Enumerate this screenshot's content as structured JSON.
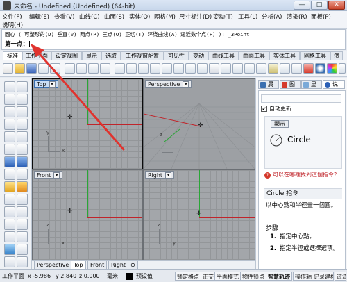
{
  "window": {
    "title": "未命名 - Undefined (Undefined) (64-bit)",
    "minimize": "—",
    "maximize": "□",
    "close": "✕"
  },
  "menu": {
    "row1": [
      "文件(F)",
      "编辑(E)",
      "查看(V)",
      "曲线(C)",
      "曲面(S)",
      "实体(O)",
      "网格(M)",
      "尺寸标注(D)",
      "变动(T)",
      "工具(L)",
      "分析(A)",
      "渲染(R)",
      "面板(P)"
    ],
    "row2": [
      "说明(H)"
    ]
  },
  "command": {
    "history": "圆心 ( 可塑形的(D) 垂直(V) 两点(P) 三点(O) 正切(T) 环绕曲线(A) 逼近数个点(F) ): _3Point",
    "prompt": "第一点："
  },
  "toolbar_tabs": [
    "标准",
    "工作平面",
    "设定视图",
    "显示",
    "选取",
    "工作视窗配置",
    "可见性",
    "变动",
    "曲线工具",
    "曲面工具",
    "实体工具",
    "网格工具",
    "渲"
  ],
  "viewports": {
    "top": "Top",
    "perspective": "Perspective",
    "front": "Front",
    "right": "Right",
    "axis_x": "x",
    "axis_y": "y",
    "axis_z": "z"
  },
  "view_tabs": [
    "Perspective",
    "Top",
    "Front",
    "Right",
    "⊕"
  ],
  "right_panel": {
    "tabs": [
      "属",
      "图",
      "显",
      "说"
    ],
    "auto_update": "自动更新",
    "display_button": "顯示",
    "command_name": "Circle",
    "link_text": "可以在哪裡找到這個指令?",
    "section_title": "Circle 指令",
    "description": "以中心點和半徑畫一個圓。",
    "steps_title": "步驟",
    "steps": [
      {
        "num": "1.",
        "text": "指定中心點。"
      },
      {
        "num": "2.",
        "text": "指定半徑或選擇選項。"
      }
    ]
  },
  "status": {
    "workplane": "工作平面",
    "x": "x -5.986",
    "y": "y 2.840",
    "z": "z 0.000",
    "units": "毫米",
    "layer": "预设值",
    "snap_lock": "锁定格点",
    "ortho": "正交",
    "planar": "平面模式",
    "osnap": "物件锁点",
    "smart_track": "智慧轨迹",
    "gumball": "操作轴",
    "record_history": "记录建构历",
    "filter": "过滤器"
  },
  "colors": {
    "accent_blue": "#3a6fb0",
    "axis_red": "#c0242a",
    "axis_green": "#2aa636",
    "annotation_red": "#e0332e"
  }
}
